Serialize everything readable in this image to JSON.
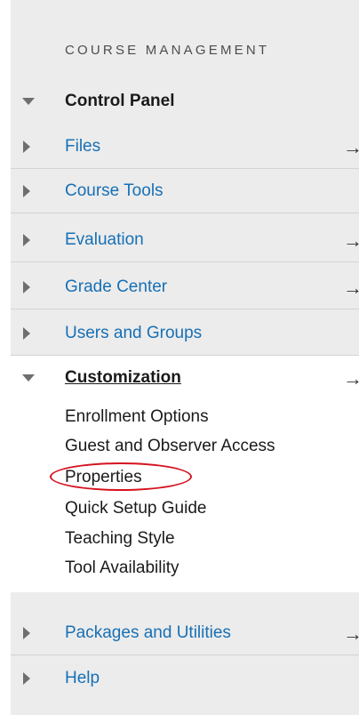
{
  "panel": {
    "header": "COURSE MANAGEMENT"
  },
  "control_panel": {
    "label": "Control Panel"
  },
  "menu": {
    "files": "Files",
    "course_tools": "Course Tools",
    "evaluation": "Evaluation",
    "grade_center": "Grade Center",
    "users_groups": "Users and Groups",
    "customization": "Customization",
    "packages": "Packages and Utilities",
    "help": "Help"
  },
  "customization_items": [
    "Enrollment Options",
    "Guest and Observer Access",
    "Properties",
    "Quick Setup Guide",
    "Teaching Style",
    "Tool Availability"
  ],
  "glyphs": {
    "arrow": "→"
  },
  "colors": {
    "link": "#1770b5",
    "highlight": "#d5121e",
    "panel_bg": "#ececec"
  }
}
